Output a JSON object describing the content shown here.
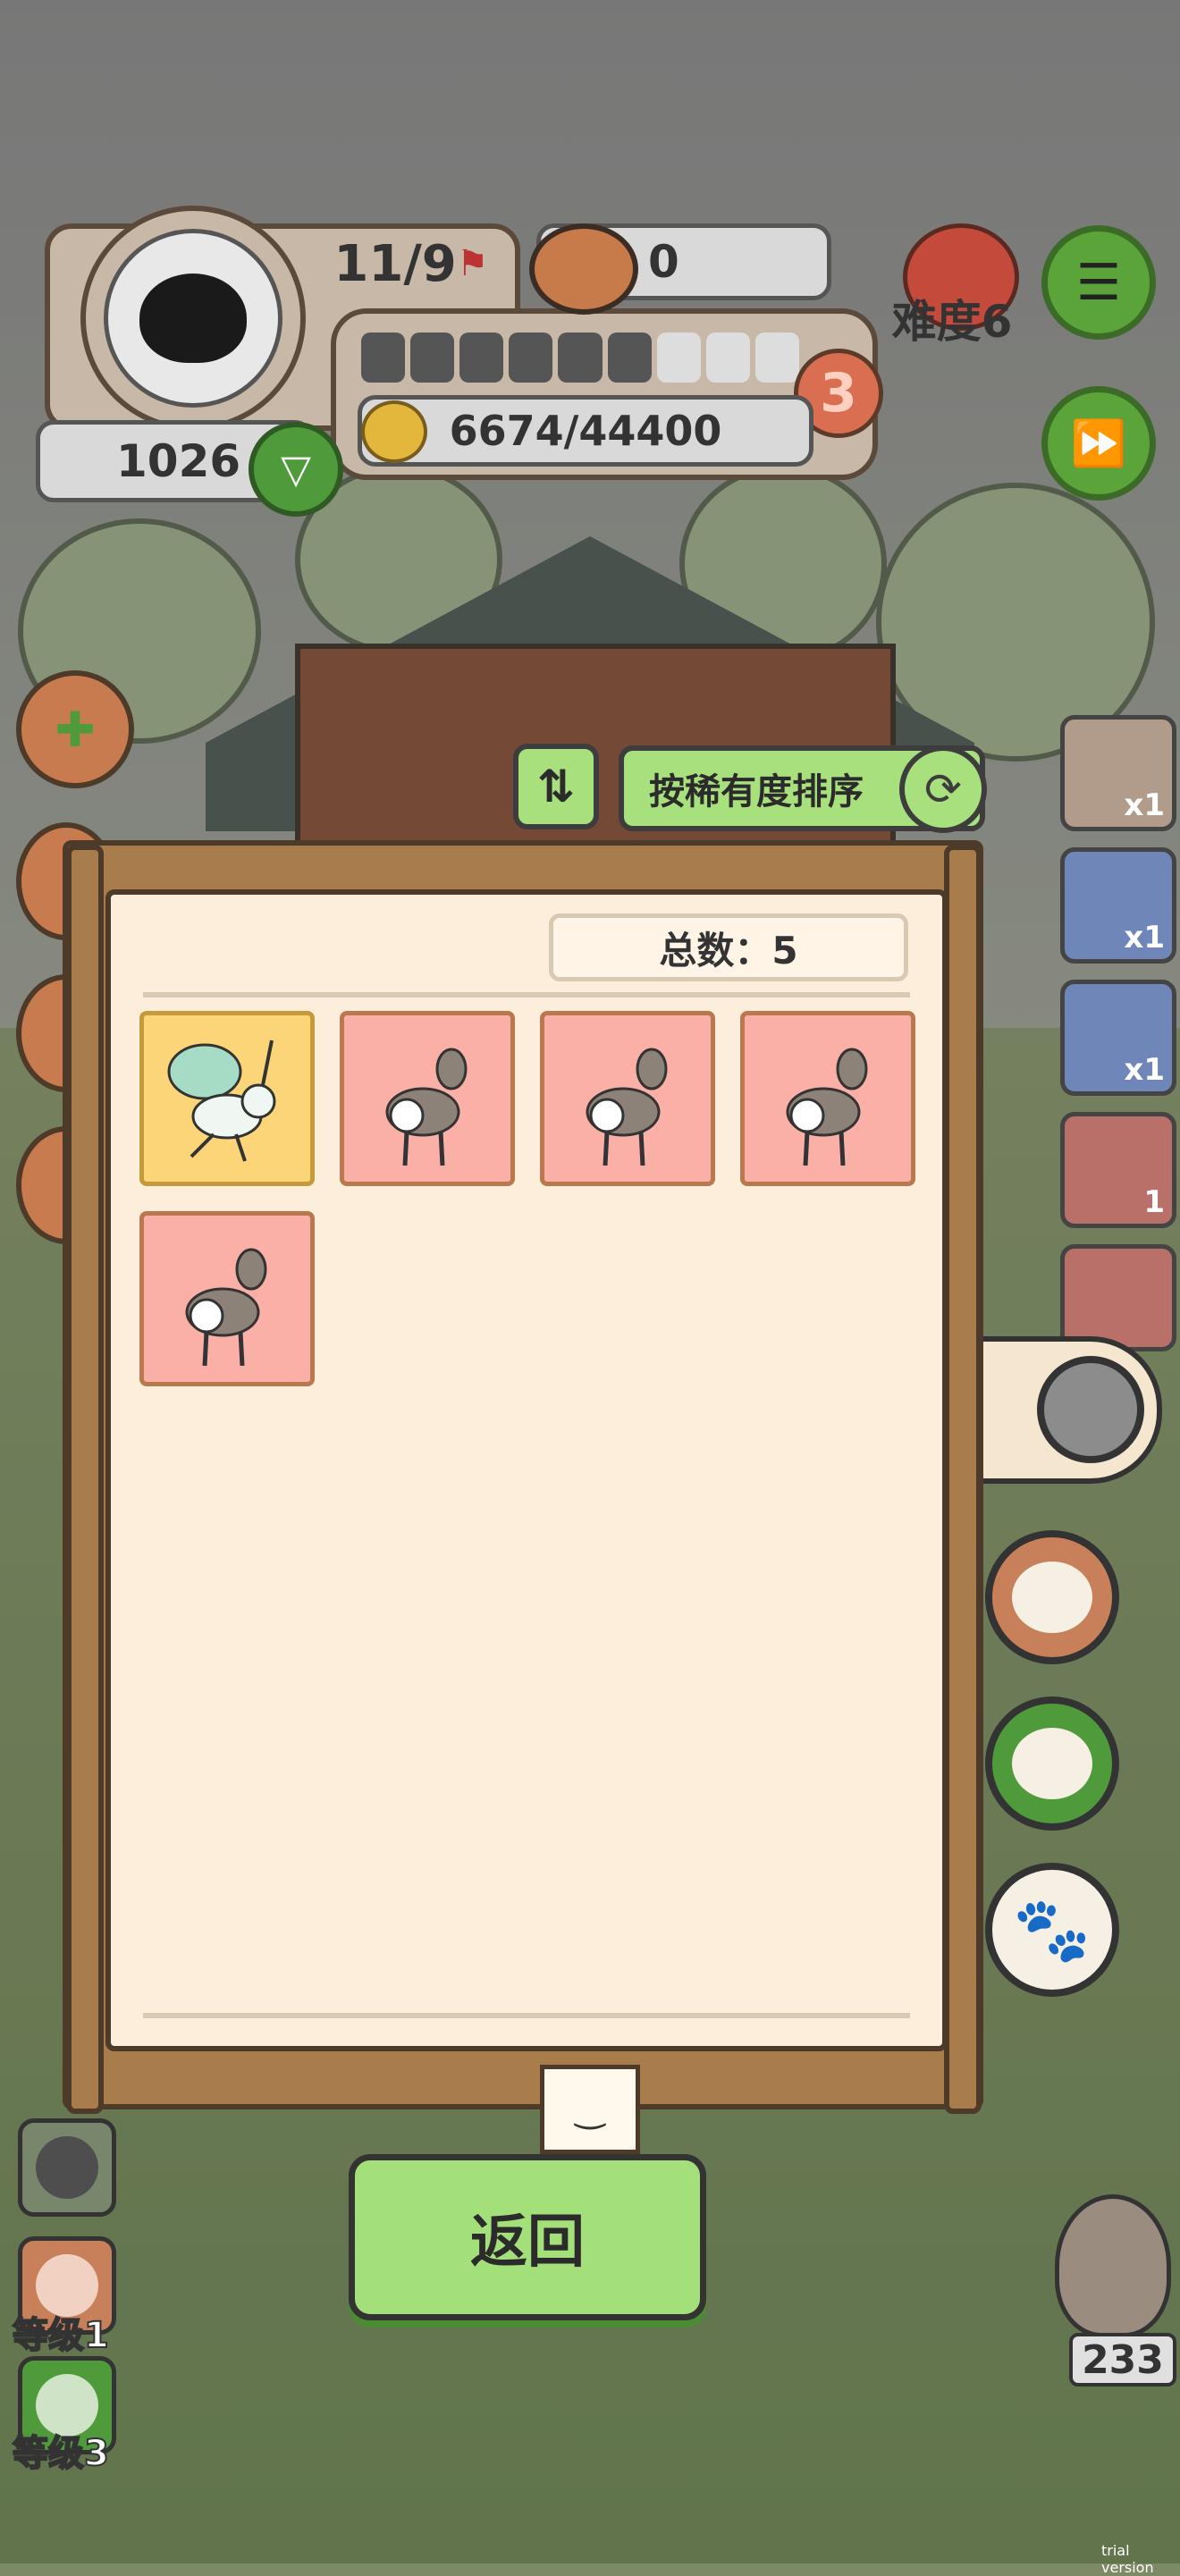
{
  "hud": {
    "population": "11/9",
    "food_count": "0",
    "difficulty": "难度6",
    "xp_text": "6674/44400",
    "level": "3",
    "coins": "1026",
    "progress_fraction": 0.67
  },
  "side_items": [
    {
      "icon": "peanut-icon",
      "count": "x1",
      "color": "#b19b8a"
    },
    {
      "icon": "bird-nest-icon",
      "count": "x1",
      "color": "#6f86b8"
    },
    {
      "icon": "seed-packet-icon",
      "count": "x1",
      "color": "#6f86b8"
    },
    {
      "icon": "hourglass-book-icon",
      "count": "1",
      "color": "#b87068"
    },
    {
      "icon": "crystal-icon",
      "count": "",
      "color": "#b87068"
    }
  ],
  "sort": {
    "label": "按稀有度排序"
  },
  "panel": {
    "total_label": "总数：5",
    "cards": [
      {
        "name": "spirit-deer",
        "rarity": "gold"
      },
      {
        "name": "deer",
        "rarity": "pink"
      },
      {
        "name": "deer",
        "rarity": "pink"
      },
      {
        "name": "deer",
        "rarity": "pink"
      },
      {
        "name": "deer",
        "rarity": "pink"
      }
    ]
  },
  "back_button": {
    "label": "返回"
  },
  "left_levels": [
    {
      "label": ""
    },
    {
      "label": "等级1"
    },
    {
      "label": "等级3"
    }
  ],
  "owl_counter": "233",
  "watermark": "trial version"
}
